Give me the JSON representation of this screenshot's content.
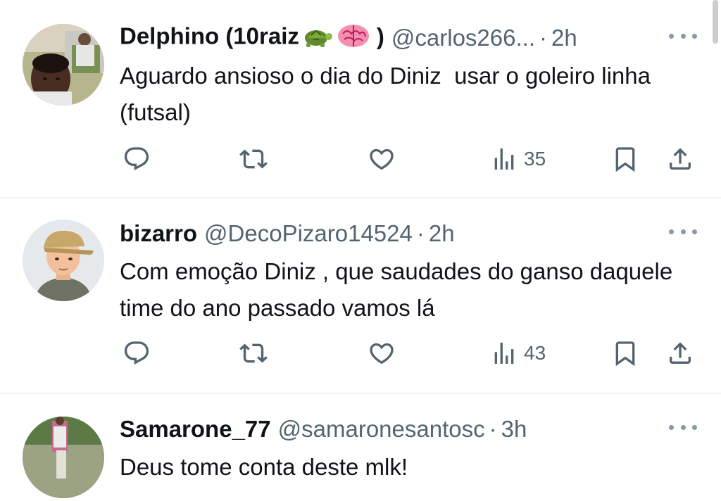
{
  "tweets": [
    {
      "display_name": "Delphino (10raiz",
      "display_name_suffix": ")",
      "emojis": [
        "turtle-emoji",
        "brain-emoji"
      ],
      "handle": "@carlos266...",
      "separator": "·",
      "time": "2h",
      "text": "Aguardo ansioso o dia do Diniz  usar o goleiro linha (futsal)",
      "views": "35",
      "avatar": "photo-avatar-man"
    },
    {
      "display_name": "bizarro",
      "display_name_suffix": "",
      "emojis": [],
      "handle": "@DecoPizaro14524",
      "separator": "·",
      "time": "2h",
      "text": "Com emoção Diniz , que saudades do ganso daquele time do ano passado vamos lá",
      "views": "43",
      "avatar": "cartoon-avatar-cap"
    },
    {
      "display_name": "Samarone_77",
      "display_name_suffix": "",
      "emojis": [],
      "handle": "@samaronesantosc",
      "separator": "·",
      "time": "3h",
      "text": "Deus tome conta deste mlk!",
      "avatar": "photo-avatar-outdoor"
    }
  ],
  "colors": {
    "text": "#0f1419",
    "muted": "#536471",
    "divider": "#eff3f4",
    "icon": "#536471"
  },
  "icons": [
    "reply-icon",
    "retweet-icon",
    "like-icon",
    "views-icon",
    "bookmark-icon",
    "share-icon",
    "more-icon"
  ]
}
